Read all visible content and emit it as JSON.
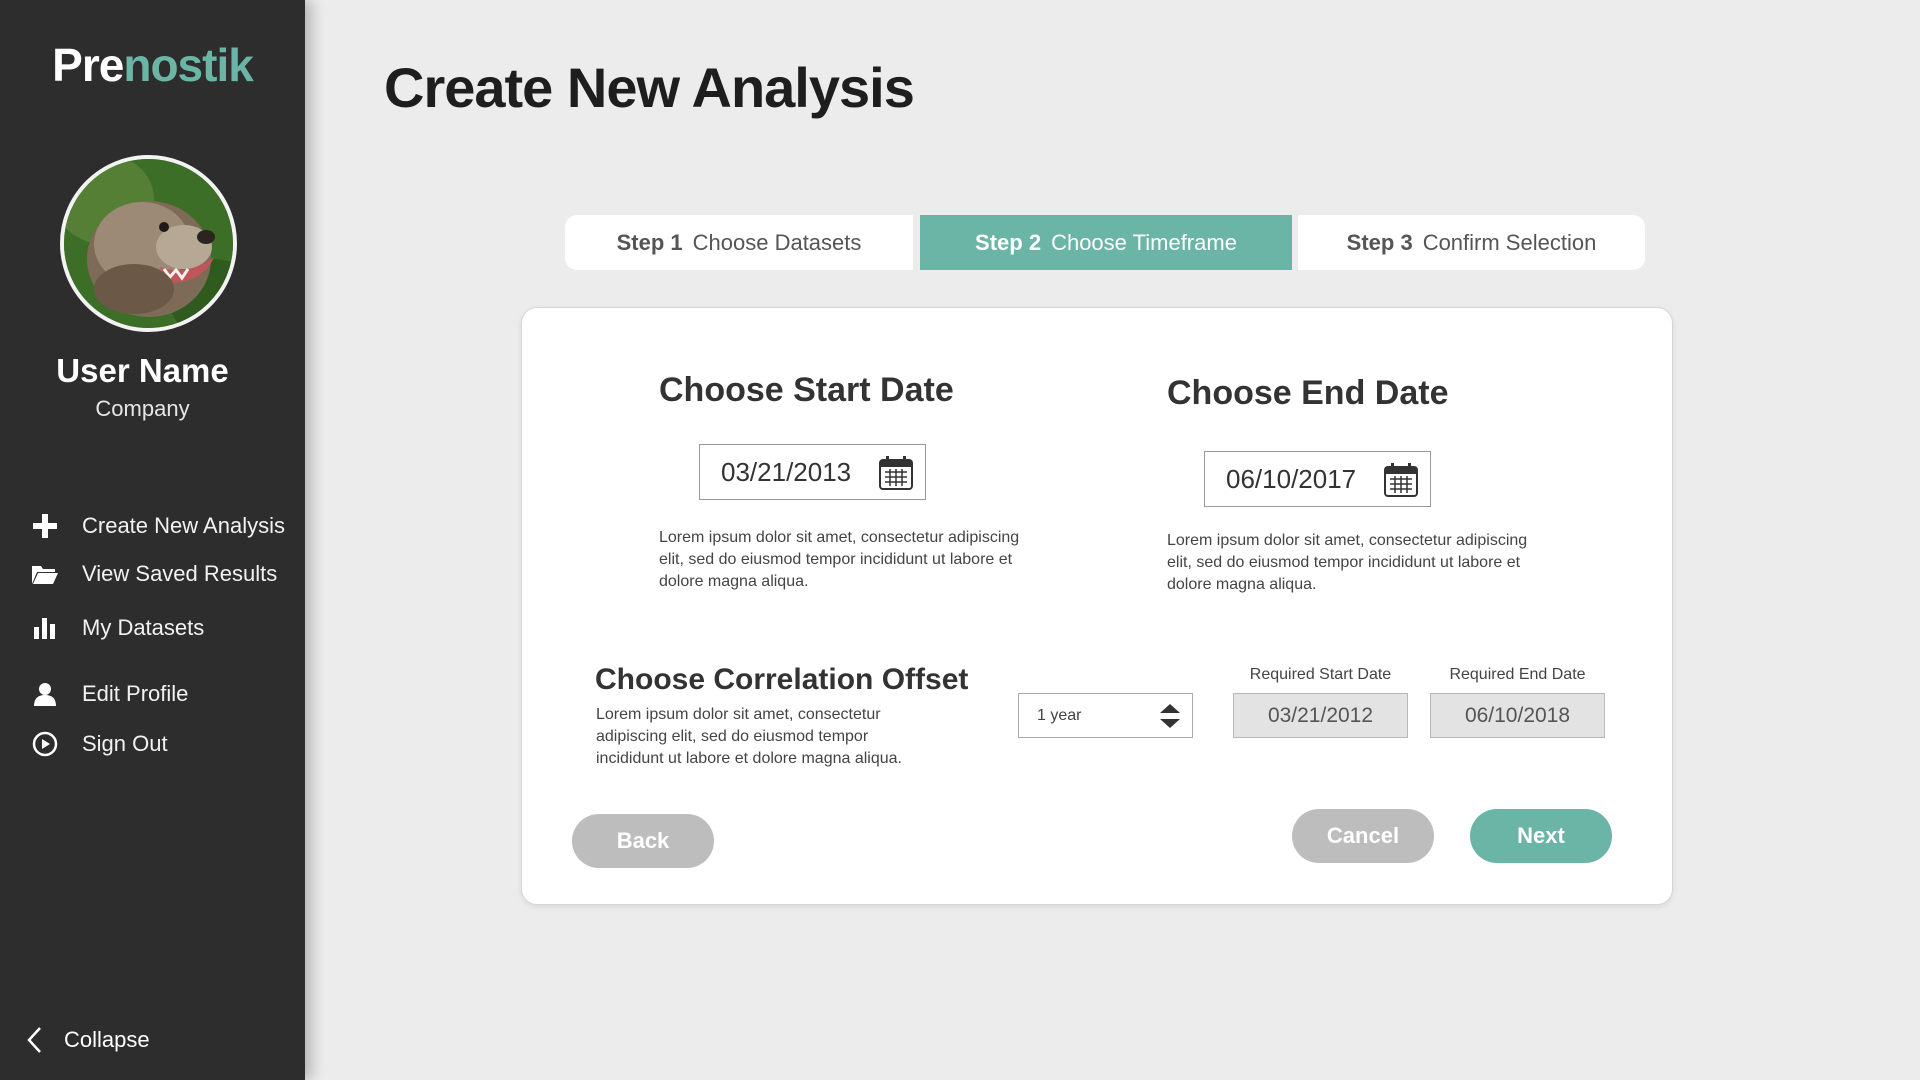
{
  "brand": {
    "part1": "Pre",
    "part2": "nostik"
  },
  "user": {
    "name": "User Name",
    "company": "Company"
  },
  "nav": [
    {
      "label": "Create New Analysis",
      "icon": "plus-icon"
    },
    {
      "label": "View Saved Results",
      "icon": "folder-icon"
    },
    {
      "label": "My Datasets",
      "icon": "bar-chart-icon"
    },
    {
      "label": "Edit Profile",
      "icon": "user-icon"
    },
    {
      "label": "Sign Out",
      "icon": "power-icon"
    }
  ],
  "collapse_label": "Collapse",
  "page_title": "Create New Analysis",
  "steps": [
    {
      "num": "Step 1",
      "label": "Choose Datasets",
      "active": false
    },
    {
      "num": "Step 2",
      "label": "Choose Timeframe",
      "active": true
    },
    {
      "num": "Step 3",
      "label": "Confirm Selection",
      "active": false
    }
  ],
  "start": {
    "title": "Choose Start Date",
    "value": "03/21/2013",
    "description": "Lorem ipsum dolor sit amet, consectetur adipiscing elit, sed do eiusmod tempor incididunt ut labore et dolore magna aliqua."
  },
  "end": {
    "title": "Choose End Date",
    "value": "06/10/2017",
    "description": "Lorem ipsum dolor sit amet, consectetur adipiscing elit, sed do eiusmod tempor incididunt ut labore et dolore magna aliqua."
  },
  "offset": {
    "title": "Choose Correlation Offset",
    "description": "Lorem ipsum dolor sit amet, consectetur adipiscing elit, sed do eiusmod tempor incididunt ut labore et dolore magna aliqua.",
    "selected": "1 year",
    "required_start_label": "Required Start Date",
    "required_start_value": "03/21/2012",
    "required_end_label": "Required End Date",
    "required_end_value": "06/10/2018"
  },
  "buttons": {
    "back": "Back",
    "cancel": "Cancel",
    "next": "Next"
  },
  "colors": {
    "accent": "#6bb5a6",
    "sidebar": "#2d2d2d",
    "background": "#ececec",
    "disabled": "#bdbdbd"
  }
}
